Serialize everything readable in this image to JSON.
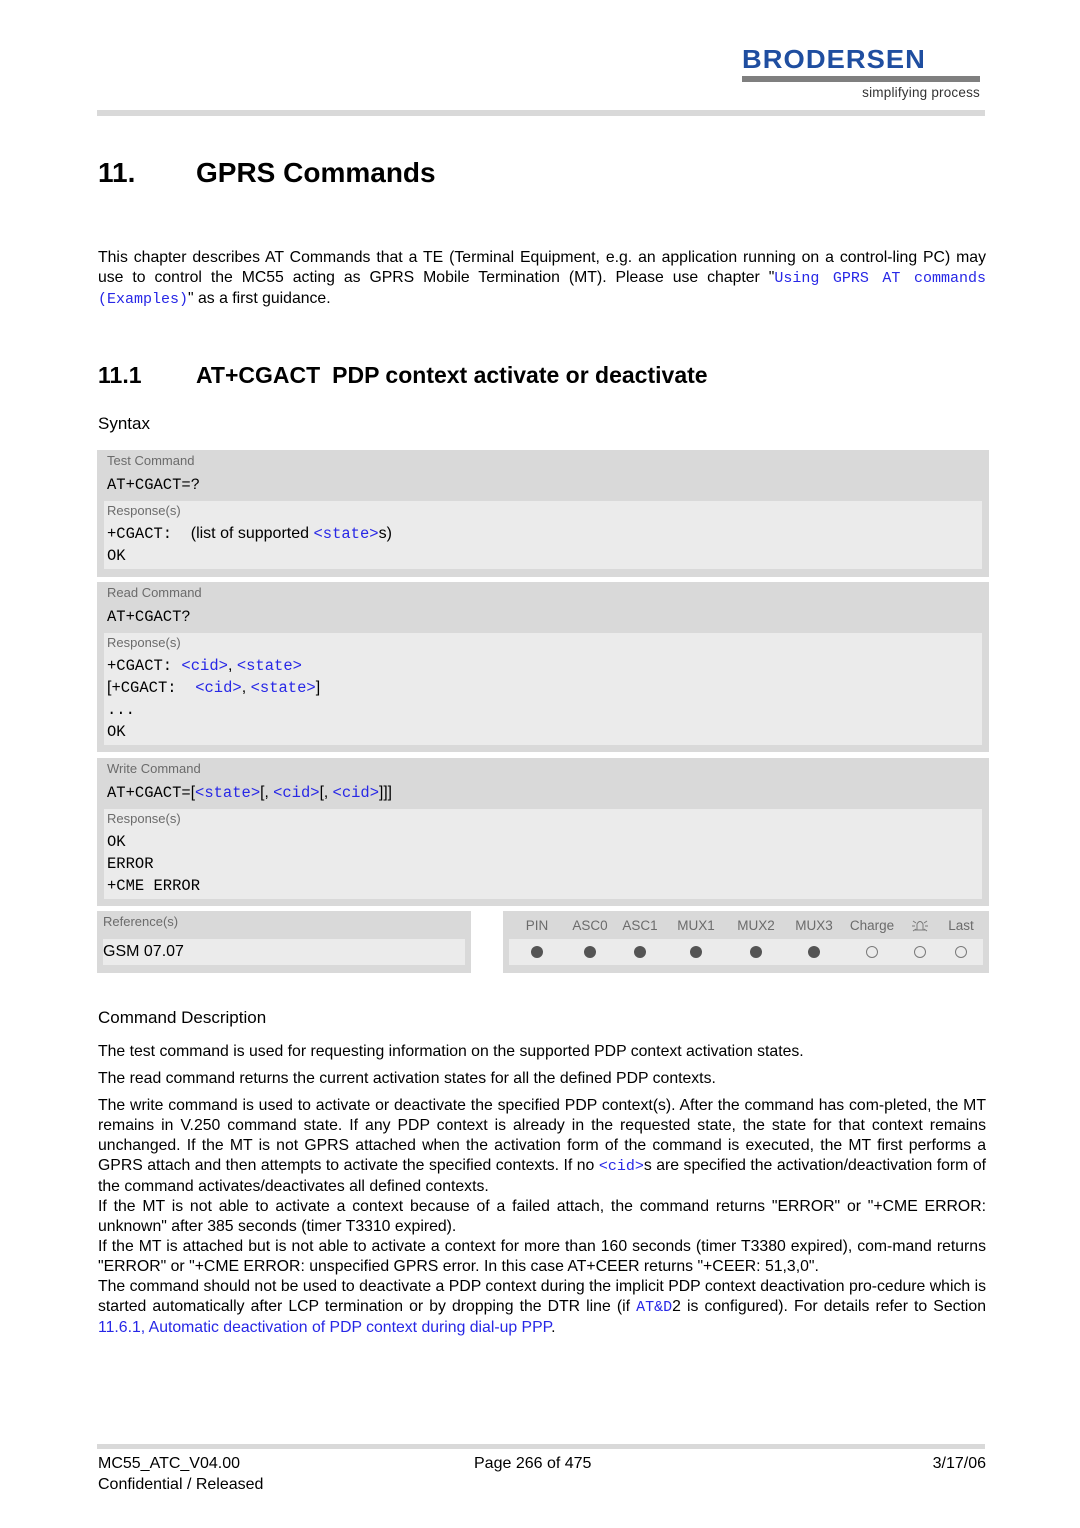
{
  "header": {
    "logo_text": "BRODERSEN",
    "logo_tagline": "simplifying process",
    "brand_color": "#1f4ea0"
  },
  "chapter": {
    "number": "11.",
    "title": "GPRS Commands",
    "intro_text_1": "This chapter describes AT Commands that a TE (Terminal Equipment, e.g. an application running on a control-ling PC) may use to control the MC55 acting as GPRS Mobile Termination (MT). Please use chapter \"",
    "intro_link": "Using GPRS AT commands (Examples)",
    "intro_text_2": "\" as a first guidance."
  },
  "section": {
    "number": "11.1",
    "command": "AT+CGACT",
    "title": "PDP context activate or deactivate",
    "syntax_label": "Syntax"
  },
  "test_command": {
    "kind": "Test Command",
    "command": "AT+CGACT=?",
    "responses_label": "Response(s)",
    "response_prefix": "+CGACT:",
    "response_text_1": "(list of supported ",
    "response_param": "<state>",
    "response_text_2": "s)",
    "response_ok": "OK"
  },
  "read_command": {
    "kind": "Read Command",
    "command": "AT+CGACT?",
    "responses_label": "Response(s)",
    "line1_prefix": "+CGACT: ",
    "line2_open": "[",
    "line2_prefix": "+CGACT: ",
    "param_cid": "<cid>",
    "sep": ", ",
    "param_state": "<state>",
    "line2_close": "]",
    "ellipsis": "...",
    "response_ok": "OK"
  },
  "write_command": {
    "kind": "Write Command",
    "command_prefix": "AT+CGACT=",
    "open1": "[",
    "param_state": "<state>",
    "open2": "[, ",
    "param_cid1": "<cid>",
    "open3": "[, ",
    "param_cid2": "<cid>",
    "close": "]]]",
    "responses_label": "Response(s)",
    "responses": [
      "OK",
      "ERROR",
      "+CME ERROR"
    ]
  },
  "reference": {
    "label": "Reference(s)",
    "value": "GSM 07.07"
  },
  "pin_table": {
    "columns": [
      {
        "label": "PIN",
        "supported": true
      },
      {
        "label": "ASC0",
        "supported": true
      },
      {
        "label": "ASC1",
        "supported": true
      },
      {
        "label": "MUX1",
        "supported": true
      },
      {
        "label": "MUX2",
        "supported": true
      },
      {
        "label": "MUX3",
        "supported": true
      },
      {
        "label": "Charge",
        "supported": false
      },
      {
        "label": "alarm-icon",
        "supported": false
      },
      {
        "label": "Last",
        "supported": false
      }
    ]
  },
  "description": {
    "title": "Command Description",
    "p1": "The test command is used for requesting information on the supported PDP context activation states.",
    "p2": "The read command returns the current activation states for all the defined PDP contexts.",
    "p3_a": "The write command is used to activate or deactivate the specified PDP context(s). After the command has com-pleted, the MT remains in V.250 command state. If any PDP context is already in the requested state, the state for that context remains unchanged. If the MT is not GPRS attached when the activation form of the command is executed, the MT first performs a GPRS attach and then attempts to activate the specified contexts. If no ",
    "p3_param": "<cid>",
    "p3_b": "s are specified the activation/deactivation form of the command activates/deactivates all defined contexts.",
    "p4": "If the MT is not able to activate a context because of a failed attach, the command returns \"ERROR\" or \"+CME ERROR: unknown\" after 385 seconds (timer T3310 expired).",
    "p5": "If the MT is attached but is not able to activate a context for more than 160 seconds (timer T3380 expired), com-mand returns \"ERROR\" or \"+CME ERROR: unspecified GPRS error. In this case AT+CEER returns \"+CEER: 51,3,0\".",
    "p6_a": "The command should not be used to deactivate a PDP context during the implicit PDP context deactivation pro-cedure which is started automatically after LCP termination or by dropping the DTR line (if ",
    "p6_cmd": "AT&D",
    "p6_b": "2 is configured). For details refer to Section ",
    "p6_link": "11.6.1, Automatic deactivation of PDP context during dial-up PPP",
    "p6_c": "."
  },
  "footer": {
    "doc_id": "MC55_ATC_V04.00",
    "page": "Page 266 of 475",
    "date": "3/17/06",
    "status": "Confidential / Released"
  }
}
